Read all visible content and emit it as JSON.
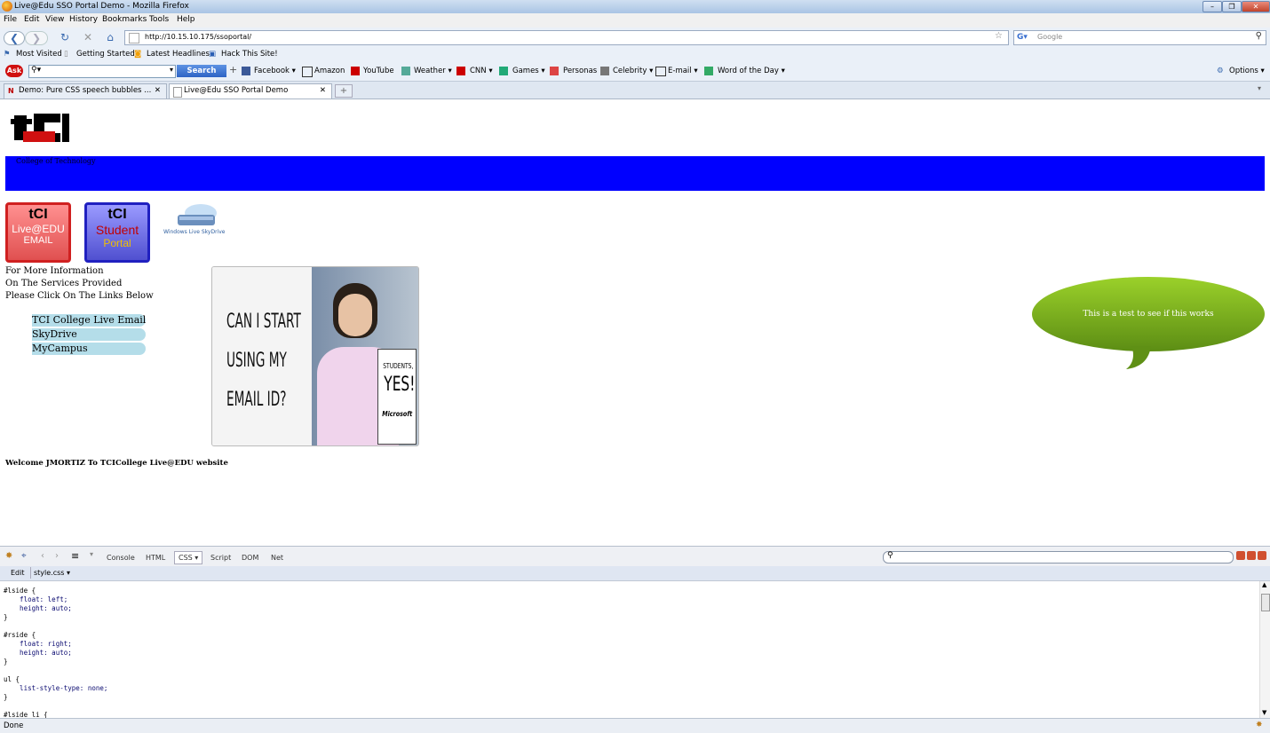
{
  "window": {
    "title": "Live@Edu SSO Portal Demo - Mozilla Firefox",
    "minimize": "–",
    "maximize": "❐",
    "close": "✕"
  },
  "menu": [
    "File",
    "Edit",
    "View",
    "History",
    "Bookmarks",
    "Tools",
    "Help"
  ],
  "nav": {
    "url": "http://10.15.10.175/ssoportal/",
    "search_placeholder": "Google"
  },
  "bookmarks": [
    "Most Visited",
    "Getting Started",
    "Latest Headlines",
    "Hack This Site!"
  ],
  "ask_toolbar": {
    "search_label": "Search",
    "items": [
      "Facebook",
      "Amazon",
      "YouTube",
      "Weather",
      "CNN",
      "Games",
      "Personas",
      "Celebrity",
      "E-mail",
      "Word of the Day"
    ],
    "options": "Options"
  },
  "tabs": [
    {
      "label": "Demo: Pure CSS speech bubbles  ...",
      "active": false
    },
    {
      "label": "Live@Edu SSO Portal Demo",
      "active": true
    }
  ],
  "page": {
    "logo_text": "tCI",
    "tagline": "College of Technology",
    "tiles": {
      "live_line1": "Live@EDU",
      "live_line2": "EMAIL",
      "student_line1": "Student",
      "student_line2": "Portal",
      "skydrive_caption": "Windows Live SkyDrive"
    },
    "info_lines": [
      "For More Information",
      "On The Services Provided",
      "Please Click On The Links Below"
    ],
    "links": [
      "TCI College Live Email",
      "SkyDrive",
      "MyCampus"
    ],
    "ad": {
      "headline": [
        "CAN I START",
        "USING MY",
        "EMAIL ID?"
      ],
      "answer_small": "STUDENTS,",
      "answer_big": "YES!",
      "brand": "Microsoft"
    },
    "welcome": "Welcome JMORTIZ To TCICollege Live@EDU website",
    "bubble_text": "This is a test to see if this works",
    "colors": {
      "bluebar": "#0000ff",
      "bubble": "#7bb21f",
      "link_bg": "#b4dde9"
    }
  },
  "firebug": {
    "tabs": [
      "Console",
      "HTML",
      "CSS",
      "Script",
      "DOM",
      "Net"
    ],
    "active_tab": "CSS",
    "edit": "Edit",
    "file": "style.css",
    "code": [
      "#lside {",
      "    float: left;",
      "    height: auto;",
      "}",
      "",
      "#rside {",
      "    float: right;",
      "    height: auto;",
      "}",
      "",
      "ul {",
      "    list-style-type: none;",
      "}",
      "",
      "#lside li {"
    ]
  },
  "status": "Done"
}
